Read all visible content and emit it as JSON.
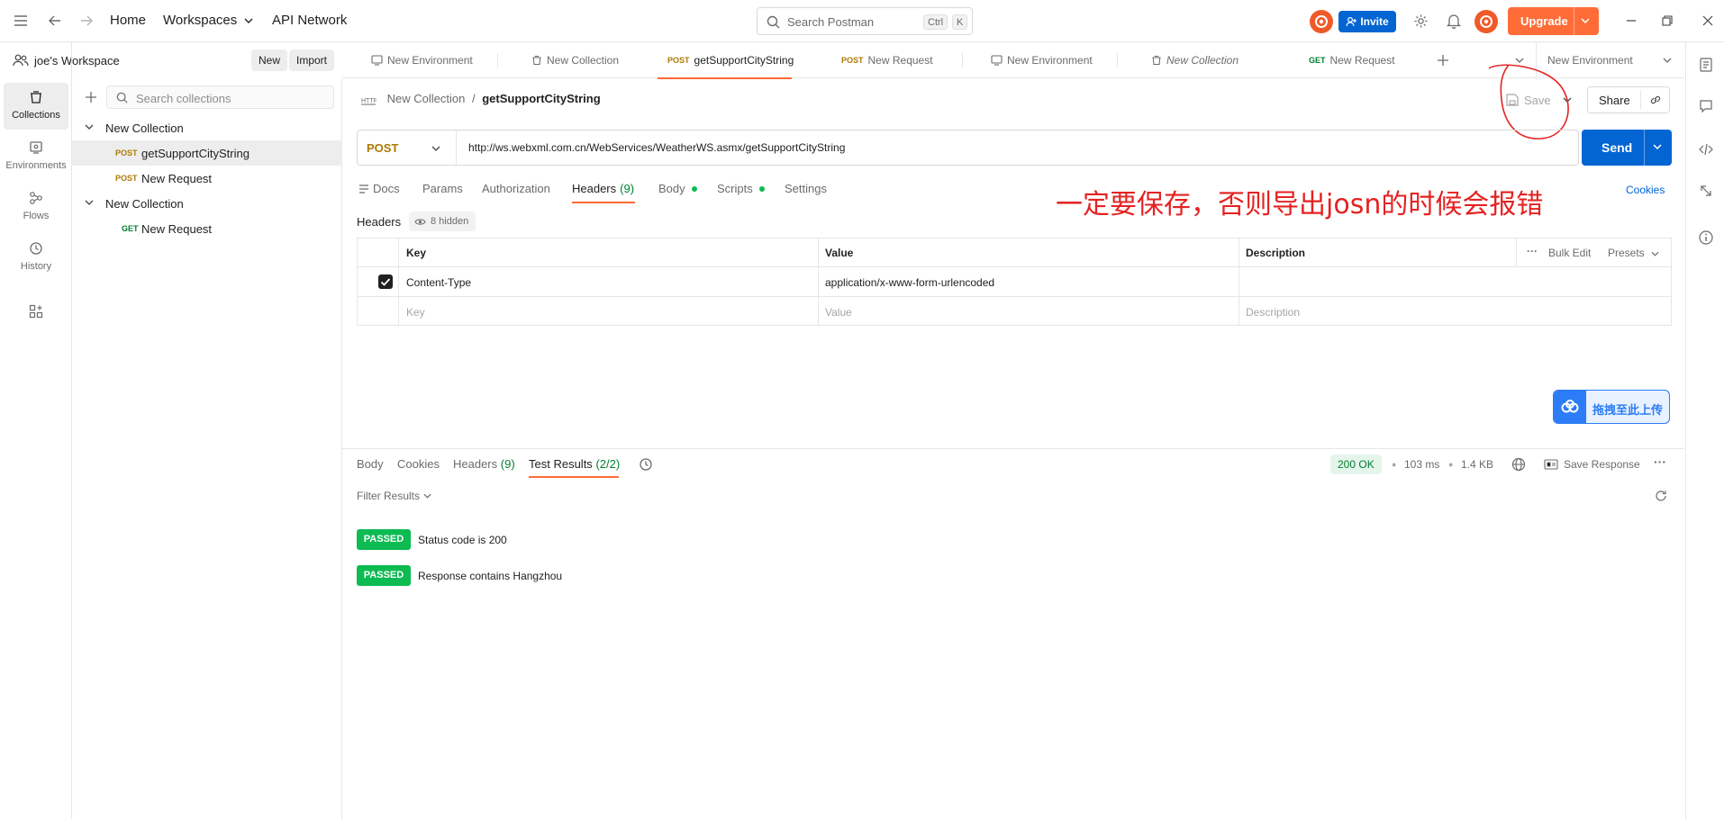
{
  "topbar": {
    "home": "Home",
    "workspaces": "Workspaces",
    "api_network": "API Network",
    "search_placeholder": "Search Postman",
    "kbd_ctrl": "Ctrl",
    "kbd_k": "K",
    "invite": "Invite",
    "upgrade": "Upgrade"
  },
  "workspace": {
    "name": "joe's Workspace",
    "new_label": "New",
    "import_label": "Import"
  },
  "rail": [
    {
      "label": "Collections",
      "icon": "trash-collections-icon"
    },
    {
      "label": "Environments",
      "icon": "environments-icon"
    },
    {
      "label": "Flows",
      "icon": "flows-icon"
    },
    {
      "label": "History",
      "icon": "history-icon"
    }
  ],
  "sidebar": {
    "search_placeholder": "Search collections",
    "tree": [
      {
        "label": "New Collection"
      },
      {
        "method": "POST",
        "label": "getSupportCityString"
      },
      {
        "method": "POST",
        "label": "New Request"
      },
      {
        "label": "New Collection"
      },
      {
        "method": "GET",
        "label": "New Request"
      }
    ]
  },
  "tabs": [
    {
      "label": "New Environment"
    },
    {
      "label": "New Collection"
    },
    {
      "method": "POST",
      "label": "getSupportCityString"
    },
    {
      "method": "POST",
      "label": "New Request"
    },
    {
      "label": "New Environment"
    },
    {
      "label": "New Collection"
    },
    {
      "method": "GET",
      "label": "New Request"
    }
  ],
  "env_select": "New Environment",
  "request": {
    "breadcrumb_parent": "New Collection",
    "breadcrumb_sep": "/",
    "breadcrumb_current": "getSupportCityString",
    "save": "Save",
    "share": "Share",
    "method": "POST",
    "url": "http://ws.webxml.com.cn/WebServices/WeatherWS.asmx/getSupportCityString",
    "send": "Send",
    "tabs": {
      "docs": "Docs",
      "params": "Params",
      "authorization": "Authorization",
      "headers": "Headers",
      "headers_count": "(9)",
      "body": "Body",
      "scripts": "Scripts",
      "settings": "Settings"
    },
    "cookies": "Cookies",
    "headers_label": "Headers",
    "hidden": "8 hidden"
  },
  "annotation": "一定要保存，否则导出josn的时候会报错",
  "headers_table": {
    "col_key": "Key",
    "col_value": "Value",
    "col_description": "Description",
    "bulk_edit": "Bulk Edit",
    "presets": "Presets",
    "rows": [
      {
        "key": "Content-Type",
        "value": "application/x-www-form-urlencoded",
        "description": ""
      }
    ],
    "placeholder_key": "Key",
    "placeholder_value": "Value",
    "placeholder_description": "Description"
  },
  "upload_badge": "拖拽至此上传",
  "response": {
    "tabs": {
      "body": "Body",
      "cookies": "Cookies",
      "headers": "Headers",
      "headers_count": "(9)",
      "test_results": "Test Results",
      "test_count": "(2/2)"
    },
    "status": "200 OK",
    "time": "103 ms",
    "size": "1.4 KB",
    "save_response": "Save Response",
    "filter": "Filter Results",
    "results": [
      {
        "badge": "PASSED",
        "text": "Status code is 200"
      },
      {
        "badge": "PASSED",
        "text": "Response contains Hangzhou"
      }
    ]
  },
  "colors": {
    "accent": "#ff6c37",
    "primary": "#0265d2",
    "post": "#ad7a03",
    "get": "#007f31",
    "passed": "#0cbb52",
    "annotation": "#e52222"
  }
}
